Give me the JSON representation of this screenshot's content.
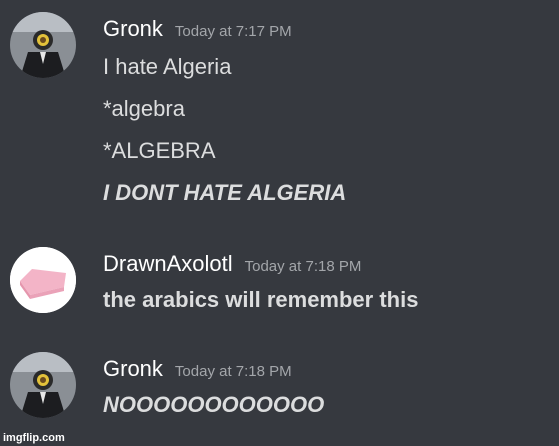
{
  "messages": [
    {
      "username": "Gronk",
      "timestamp": "Today at 7:17 PM",
      "avatar_icon": "suited-man-sunflower-avatar",
      "lines": [
        "I hate Algeria",
        "*algebra",
        "*ALGEBRA",
        "I DONT HATE ALGERIA"
      ]
    },
    {
      "username": "DrawnAxolotl",
      "timestamp": "Today at 7:18 PM",
      "avatar_icon": "pink-eraser-avatar",
      "lines": [
        "the arabics will remember this"
      ]
    },
    {
      "username": "Gronk",
      "timestamp": "Today at 7:18 PM",
      "avatar_icon": "suited-man-sunflower-avatar",
      "lines": [
        "NOOOOOOOOOOOO"
      ]
    }
  ],
  "watermark": "imgflip.com",
  "colors": {
    "background": "#36393f",
    "username": "#ffffff",
    "timestamp": "#a3a6aa",
    "text": "#dcddde"
  }
}
